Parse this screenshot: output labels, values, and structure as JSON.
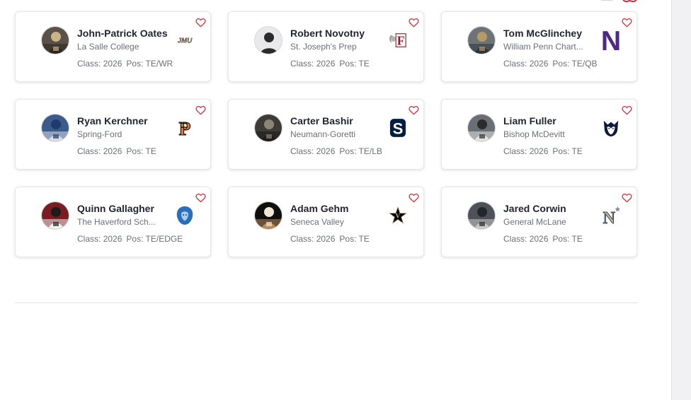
{
  "colors": {
    "accent": "#d0303f",
    "name": "#1f2430",
    "muted": "#6b7079",
    "rail": "#f1f1f3"
  },
  "players": [
    {
      "name": "John-Patrick Oates",
      "school": "La Salle College",
      "class_label": "Class:",
      "class_year": "2026",
      "pos_label": "Pos:",
      "position": "TE/WR",
      "logo": "jmu-logo",
      "logo_text": "JMU"
    },
    {
      "name": "Robert Novotny",
      "school": "St. Joseph's Prep",
      "class_label": "Class:",
      "class_year": "2026",
      "pos_label": "Pos:",
      "position": "TE",
      "logo": "fordham-ram-logo",
      "logo_text": "F"
    },
    {
      "name": "Tom McGlinchey",
      "school": "William Penn Chart...",
      "class_label": "Class:",
      "class_year": "2026",
      "pos_label": "Pos:",
      "position": "TE/QB",
      "logo": "northwestern-logo",
      "logo_text": "N"
    },
    {
      "name": "Ryan Kerchner",
      "school": "Spring-Ford",
      "class_label": "Class:",
      "class_year": "2026",
      "pos_label": "Pos:",
      "position": "TE",
      "logo": "princeton-logo",
      "logo_text": "P"
    },
    {
      "name": "Carter Bashir",
      "school": "Neumann-Goretti",
      "class_label": "Class:",
      "class_year": "2026",
      "pos_label": "Pos:",
      "position": "TE/LB",
      "logo": "penn-state-logo",
      "logo_text": "S"
    },
    {
      "name": "Liam Fuller",
      "school": "Bishop McDevitt",
      "class_label": "Class:",
      "class_year": "2026",
      "pos_label": "Pos:",
      "position": "TE",
      "logo": "uconn-husky-logo",
      "logo_text": ""
    },
    {
      "name": "Quinn Gallagher",
      "school": "The Haverford Sch...",
      "class_label": "Class:",
      "class_year": "2026",
      "pos_label": "Pos:",
      "position": "TE/EDGE",
      "logo": "columbia-lion-logo",
      "logo_text": ""
    },
    {
      "name": "Adam Gehm",
      "school": "Seneca Valley",
      "class_label": "Class:",
      "class_year": "2026",
      "pos_label": "Pos:",
      "position": "TE",
      "logo": "vanderbilt-star-logo",
      "logo_text": "V"
    },
    {
      "name": "Jared Corwin",
      "school": "General McLane",
      "class_label": "Class:",
      "class_year": "2026",
      "pos_label": "Pos:",
      "position": "TE",
      "logo": "navy-logo",
      "logo_text": "N"
    }
  ]
}
